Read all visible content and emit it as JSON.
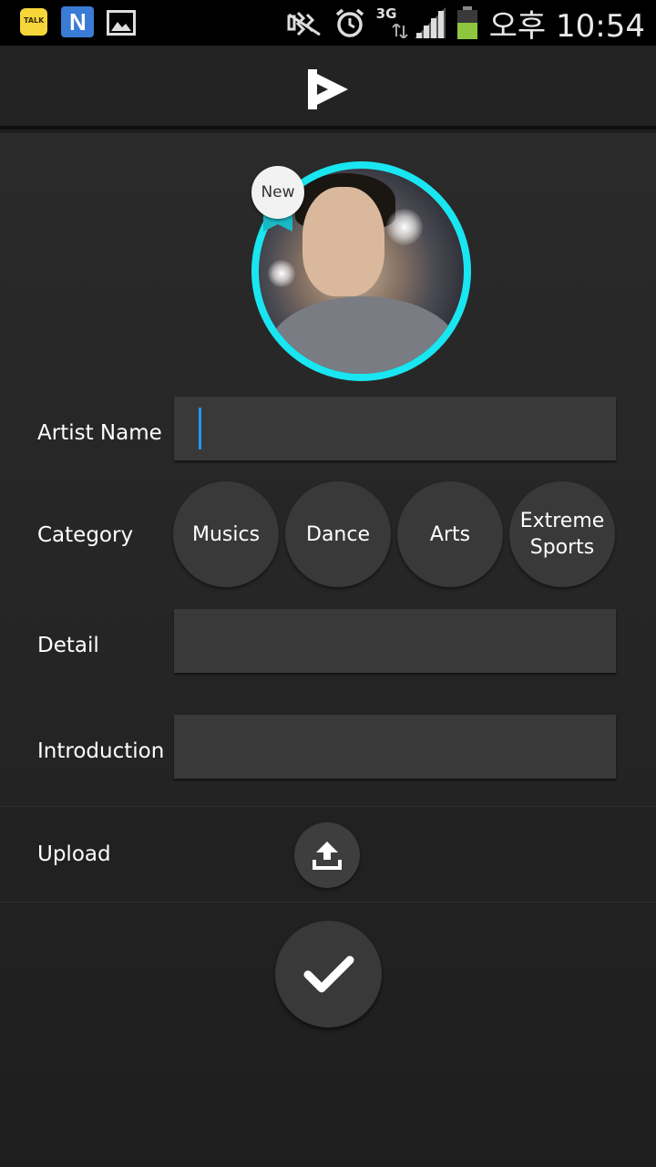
{
  "status_bar": {
    "time": "오후 10:54",
    "network": "3G",
    "notifications": [
      "kakaotalk-icon",
      "n-app-icon",
      "gallery-icon"
    ],
    "kakao_label": "TALK",
    "n_label": "N"
  },
  "header": {
    "logo": "play-logo-icon"
  },
  "profile": {
    "badge": "New"
  },
  "form": {
    "artist_name_label": "Artist Name",
    "artist_name_value": "",
    "category_label": "Category",
    "categories": [
      "Musics",
      "Dance",
      "Arts",
      "Extreme Sports"
    ],
    "detail_label": "Detail",
    "detail_value": "",
    "introduction_label": "Introduction",
    "introduction_value": "",
    "upload_label": "Upload"
  },
  "colors": {
    "accent": "#19e6f0",
    "cursor": "#2196f3",
    "field_bg": "#393939"
  }
}
